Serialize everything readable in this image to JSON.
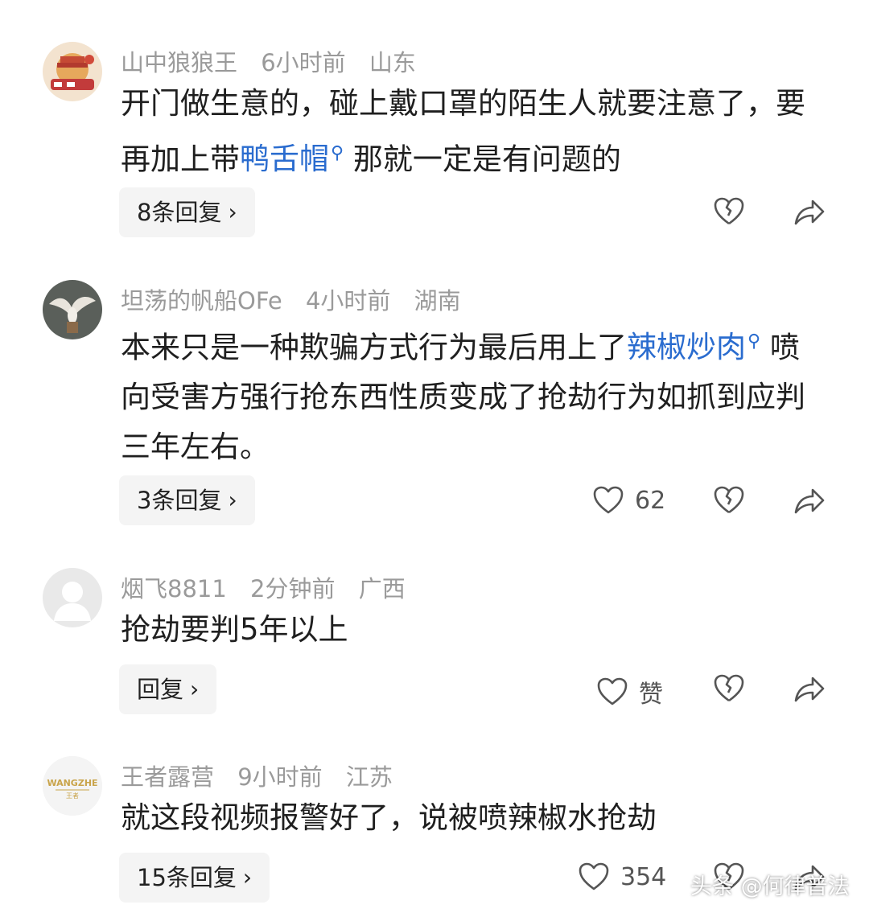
{
  "comments": [
    {
      "user": "山中狼狼王",
      "time": "6小时前",
      "region": "山东",
      "text_part1": "开门做生意的，碰上戴口罩的陌生人就要注意了，要再加上带",
      "link": "鸭舌帽",
      "text_part2": "那就一定是有问题的",
      "reply_label": "8条回复",
      "likes": ""
    },
    {
      "user": "坦荡的帆船OFe",
      "time": "4小时前",
      "region": "湖南",
      "text_part1": "本来只是一种欺骗方式行为最后用上了",
      "link": "辣椒炒肉",
      "text_part2": "喷向受害方强行抢东西性质变成了抢劫行为如抓到应判三年左右。",
      "reply_label": "3条回复",
      "likes": "62"
    },
    {
      "user": "烟飞8811",
      "time": "2分钟前",
      "region": "广西",
      "text": "抢劫要判5年以上",
      "reply_label": "回复",
      "likes": "赞"
    },
    {
      "user": "王者露营",
      "time": "9小时前",
      "region": "江苏",
      "text": "就这段视频报警好了，说被喷辣椒水抢劫",
      "reply_label": "15条回复",
      "likes": "354",
      "avatar_text_top": "WANGZHE",
      "avatar_text_bottom": "王者"
    }
  ],
  "watermark": "头条 @何律普法",
  "colors": {
    "link": "#2a6ccf",
    "meta": "#9a9a9a",
    "reply_bg": "#f4f4f4"
  },
  "icons": [
    "heart-icon",
    "broken-heart-icon",
    "share-arrow-icon",
    "chevron-right-icon",
    "search-icon"
  ]
}
